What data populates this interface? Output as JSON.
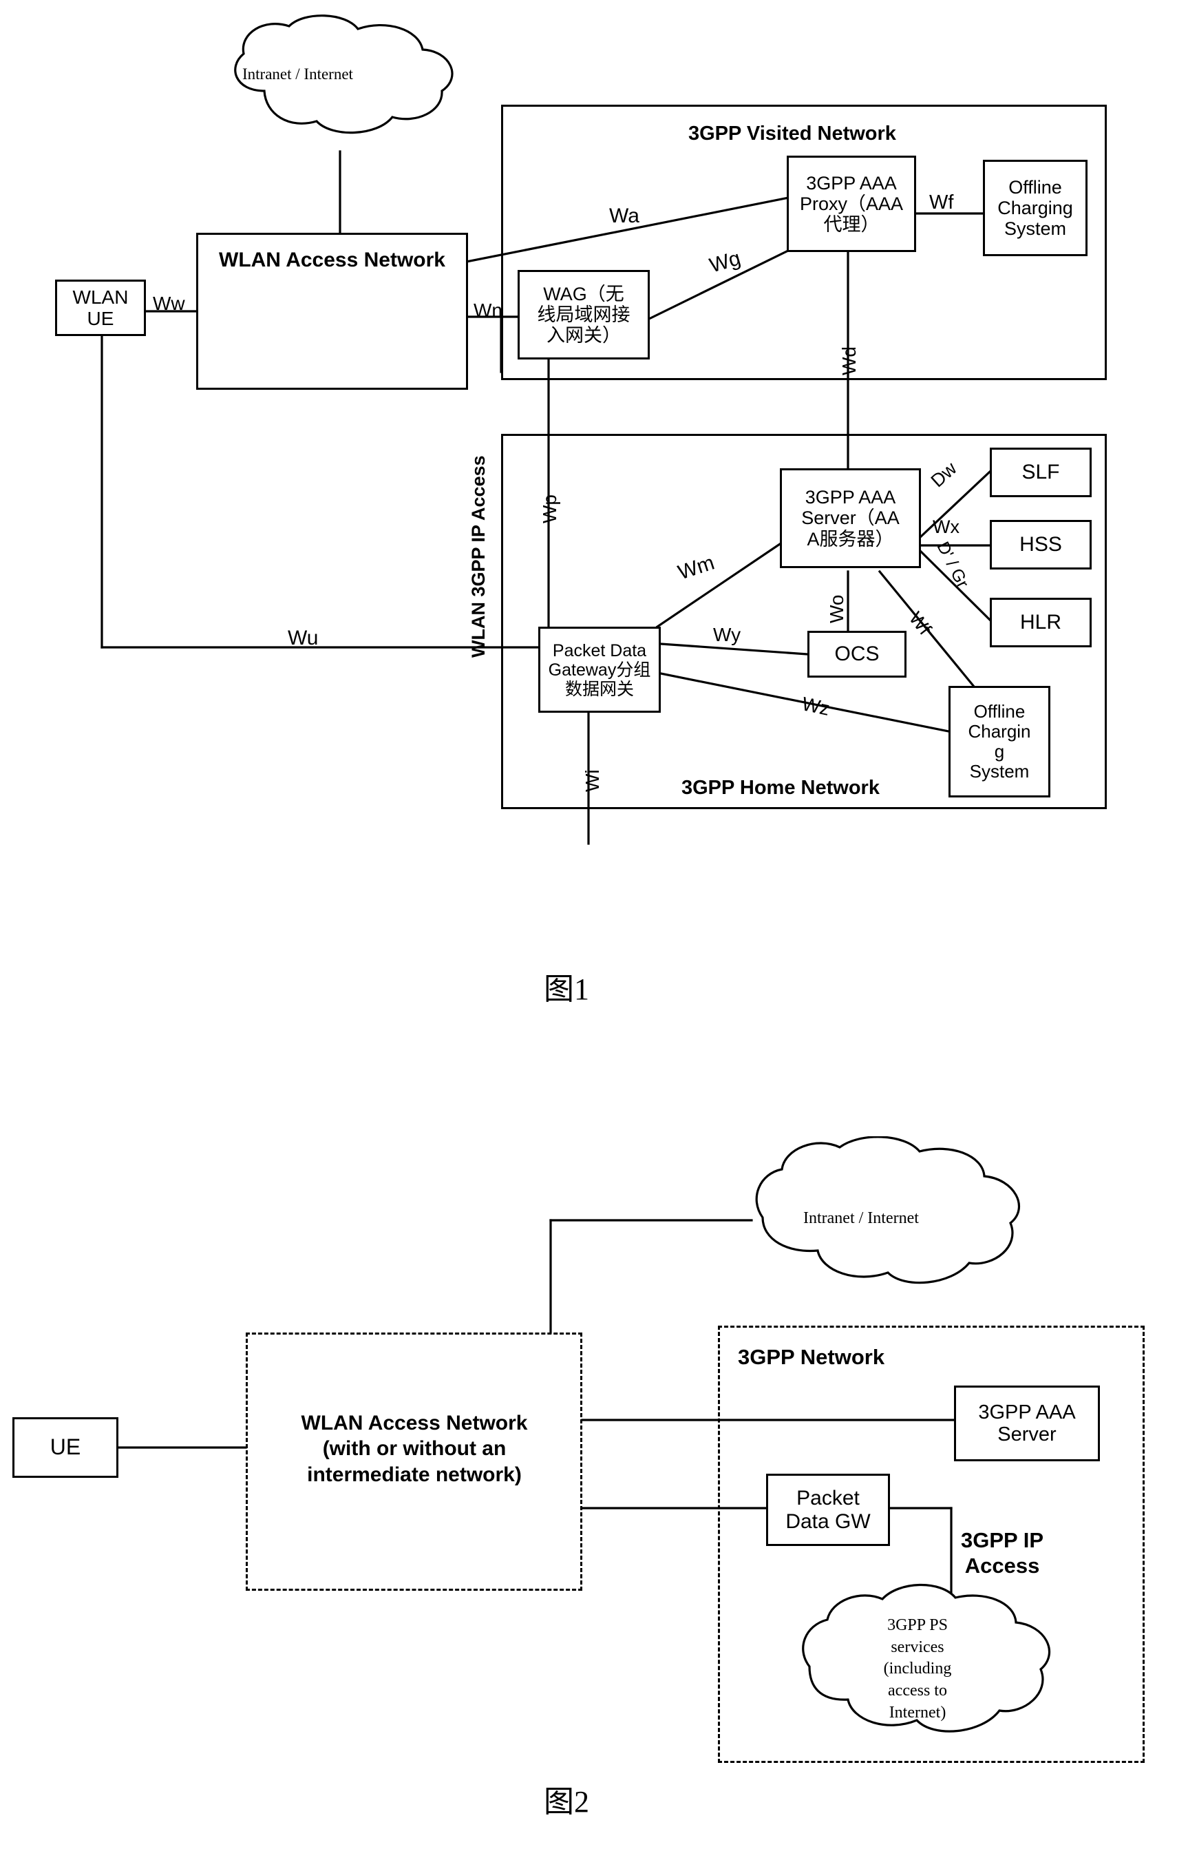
{
  "figure1": {
    "caption": "图1",
    "clouds": [
      {
        "id": "intranet",
        "label": "Intranet / Internet"
      }
    ],
    "regions": [
      {
        "id": "visited",
        "label": "3GPP Visited Network"
      },
      {
        "id": "home",
        "label": "3GPP Home Network"
      }
    ],
    "vertical_label": "WLAN 3GPP IP Access",
    "nodes": [
      {
        "id": "wlan-ue",
        "label": "WLAN\nUE"
      },
      {
        "id": "wlan-access-network",
        "label": "WLAN Access Network"
      },
      {
        "id": "wag",
        "label": "WAG（无\n线局域网接\n入网关）"
      },
      {
        "id": "aaa-proxy",
        "label": "3GPP AAA\nProxy（AAA\n代理）"
      },
      {
        "id": "offline-charging-visited",
        "label": "Offline\nCharging\nSystem"
      },
      {
        "id": "aaa-server",
        "label": "3GPP AAA\nServer（AA\nA服务器）"
      },
      {
        "id": "slf",
        "label": "SLF"
      },
      {
        "id": "hss",
        "label": "HSS"
      },
      {
        "id": "hlr",
        "label": "HLR"
      },
      {
        "id": "pdg",
        "label": "Packet Data\nGateway分组\n数据网关"
      },
      {
        "id": "ocs",
        "label": "OCS"
      },
      {
        "id": "offline-charging-home",
        "label": "Offline\nChargin\ng\nSystem"
      }
    ],
    "interfaces": [
      {
        "id": "ww",
        "label": "Ww"
      },
      {
        "id": "wa",
        "label": "Wa"
      },
      {
        "id": "wn",
        "label": "Wn"
      },
      {
        "id": "wg",
        "label": "Wg"
      },
      {
        "id": "wf-visited",
        "label": "Wf"
      },
      {
        "id": "wd",
        "label": "Wd"
      },
      {
        "id": "wp",
        "label": "Wp"
      },
      {
        "id": "wm",
        "label": "Wm"
      },
      {
        "id": "wu",
        "label": "Wu"
      },
      {
        "id": "dw",
        "label": "Dw"
      },
      {
        "id": "wx",
        "label": "Wx"
      },
      {
        "id": "d-gr",
        "label": "D' / Gr"
      },
      {
        "id": "wo",
        "label": "Wo"
      },
      {
        "id": "wy",
        "label": "Wy"
      },
      {
        "id": "wz",
        "label": "Wz"
      },
      {
        "id": "wf-home",
        "label": "Wf"
      },
      {
        "id": "wi",
        "label": "Wi"
      }
    ]
  },
  "figure2": {
    "caption": "图2",
    "clouds": [
      {
        "id": "intranet2",
        "label": "Intranet / Internet"
      },
      {
        "id": "ps-services",
        "label": "3GPP PS\nservices\n(including\naccess to\nInternet)"
      }
    ],
    "regions": [
      {
        "id": "wlan-access-region",
        "label": "WLAN Access Network\n(with or without an\nintermediate network)"
      },
      {
        "id": "3gpp-network-region",
        "label": "3GPP Network"
      }
    ],
    "nodes": [
      {
        "id": "ue",
        "label": "UE"
      },
      {
        "id": "aaa-server-2",
        "label": "3GPP AAA\nServer"
      },
      {
        "id": "packet-data-gw",
        "label": "Packet\nData GW"
      }
    ],
    "labels": [
      {
        "id": "3gpp-ip-access",
        "label": "3GPP IP\nAccess"
      }
    ]
  },
  "colors": {
    "stroke": "#000000",
    "background": "#ffffff"
  }
}
